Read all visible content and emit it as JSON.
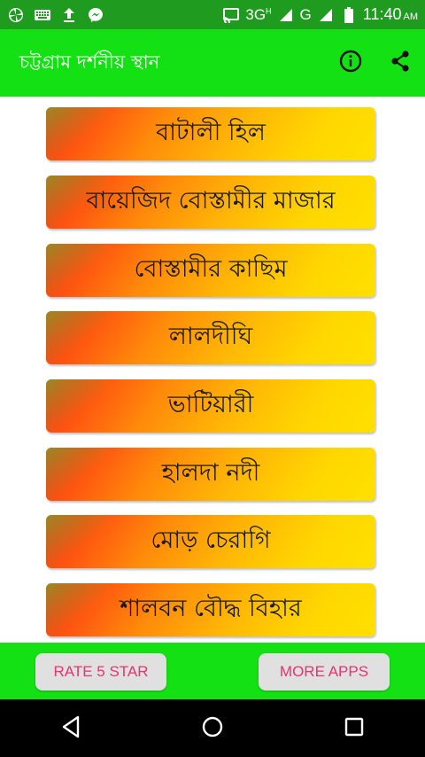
{
  "status_bar": {
    "network_label": "3G",
    "network_superscript": "H",
    "network2_label": "G",
    "time": "11:40",
    "time_suffix": "AM"
  },
  "app_bar": {
    "title": "চট্টগ্রাম দর্শনীয় স্থান",
    "icons": [
      "info-icon",
      "share-icon"
    ]
  },
  "list": {
    "items": [
      {
        "label": "বাটালী হিল"
      },
      {
        "label": "বায়েজিদ বোস্তামীর মাজার"
      },
      {
        "label": "বোস্তামীর কাছিম"
      },
      {
        "label": "লালদীঘি"
      },
      {
        "label": "ভাটিয়ারী"
      },
      {
        "label": "হালদা নদী"
      },
      {
        "label": "মোড় চেরাগি"
      },
      {
        "label": "শালবন বৌদ্ধ বিহার"
      }
    ]
  },
  "bottom_bar": {
    "rate_label": "RATE 5 STAR",
    "more_label": "MORE APPS"
  },
  "colors": {
    "status_bar": "#1f9c1f",
    "app_bar": "#14e114",
    "button_text": "#e8336e",
    "item_gradient_start": "#ff2a1a",
    "item_gradient_end": "#ffe000"
  }
}
